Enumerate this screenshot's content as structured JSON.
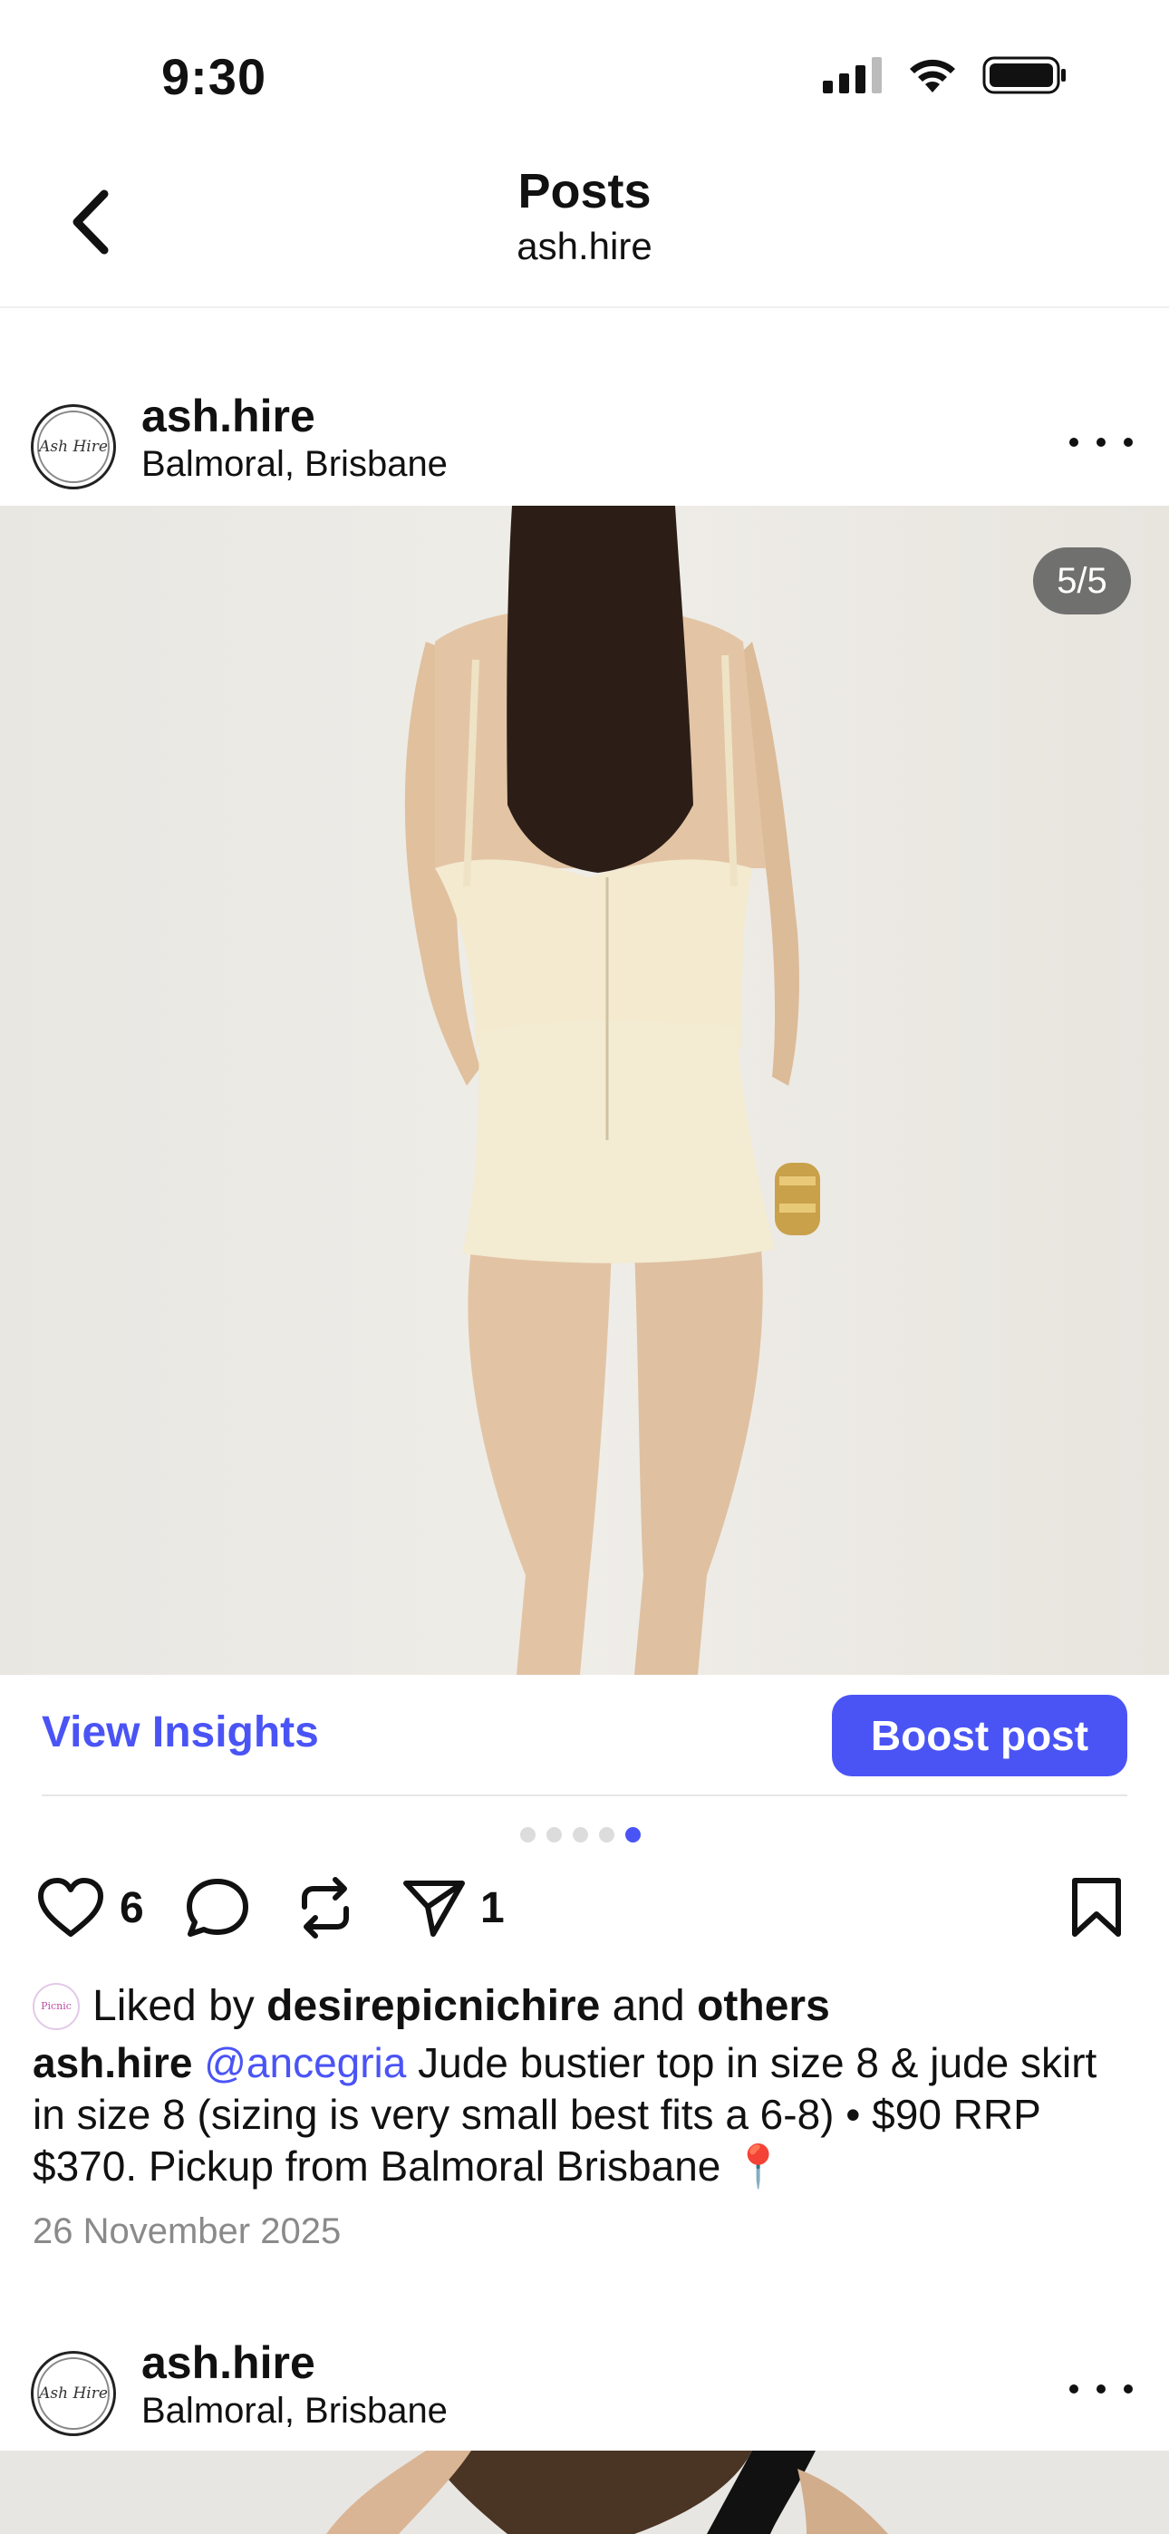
{
  "status_bar": {
    "time": "9:30"
  },
  "header": {
    "title": "Posts",
    "subtitle": "ash.hire"
  },
  "posts": [
    {
      "username": "ash.hire",
      "location": "Balmoral, Brisbane",
      "avatar_text": "Ash Hire",
      "image_counter": "5/5",
      "view_insights_label": "View Insights",
      "boost_label": "Boost post",
      "carousel": {
        "count": 5,
        "active_index": 4
      },
      "likes": "6",
      "shares": "1",
      "liked_by": {
        "prefix": "Liked by",
        "user": "desirepicnichire",
        "connector": "and",
        "suffix": "others",
        "avatar_text": "Picnic"
      },
      "caption": {
        "username": "ash.hire",
        "mention": "@ancegria",
        "text": "Jude bustier top in size 8 & jude skirt in size 8 (sizing is very small best fits a 6-8) • $90 RRP $370. Pickup from Balmoral Brisbane 📍"
      },
      "date": "26 November 2025"
    },
    {
      "username": "ash.hire",
      "location": "Balmoral, Brisbane",
      "avatar_text": "Ash Hire"
    }
  ],
  "colors": {
    "accent": "#4a54f5",
    "muted": "#8a8a8a"
  },
  "icons": [
    "back-chevron-icon",
    "signal-icon",
    "wifi-icon",
    "battery-icon",
    "more-icon",
    "heart-icon",
    "comment-icon",
    "repost-icon",
    "share-icon",
    "bookmark-icon"
  ]
}
